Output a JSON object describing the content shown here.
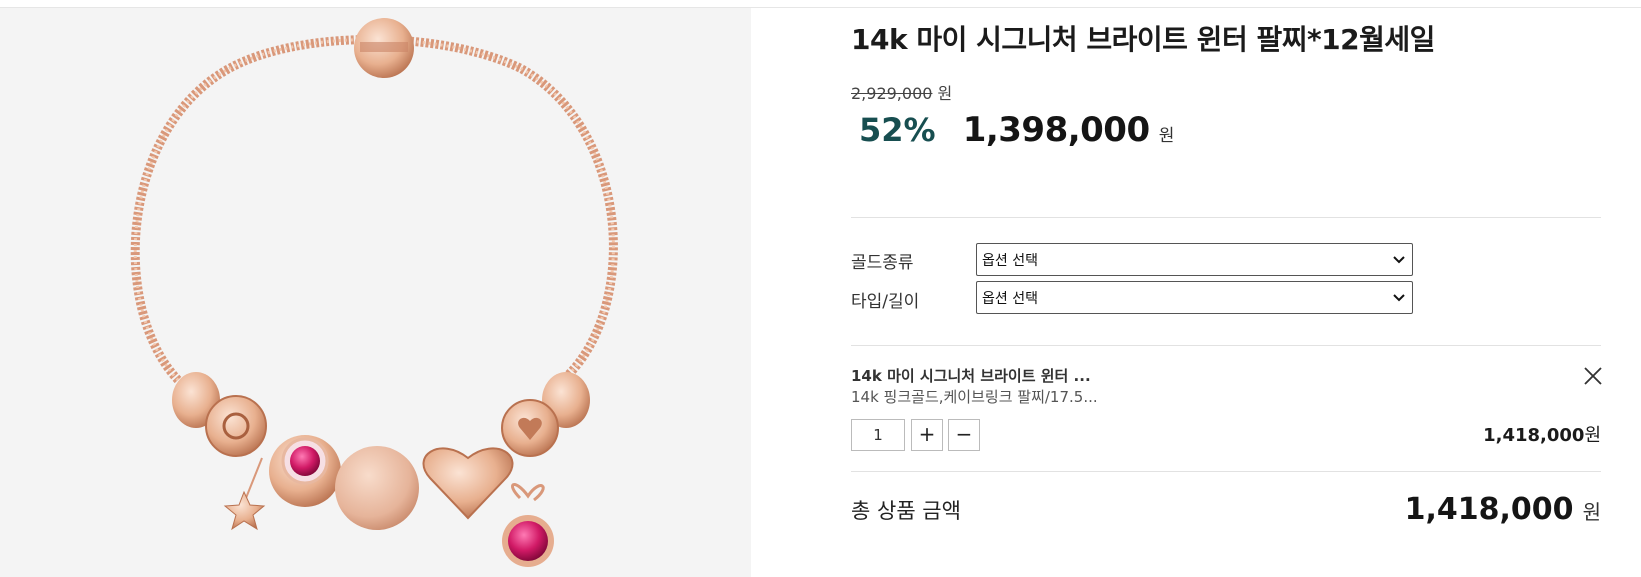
{
  "product": {
    "title": "14k 마이 시그니처 브라이트 윈터 팔찌*12월세일",
    "original_price": "2,929,000",
    "original_price_unit": "원",
    "discount": "52%",
    "sale_price": "1,398,000",
    "sale_price_unit": "원",
    "image_icon": "bracelet-image"
  },
  "options": [
    {
      "label": "골드종류",
      "value": "옵션 선택"
    },
    {
      "label": "타입/길이",
      "value": "옵션 선택"
    }
  ],
  "selected_item": {
    "name": "14k 마이 시그니처 브라이트 윈터 ...",
    "options": "14k 핑크골드,케이브링크 팔찌/17.5...",
    "quantity": "1",
    "plus": "+",
    "minus": "−",
    "price": "1,418,000",
    "price_unit": "원"
  },
  "total": {
    "label": "총 상품 금액",
    "price": "1,418,000",
    "unit": "원"
  },
  "colors": {
    "discount": "#174e50",
    "image_bg": "#f4f4f4",
    "rose_gold": "#e0a485",
    "ruby": "#c2185b"
  }
}
